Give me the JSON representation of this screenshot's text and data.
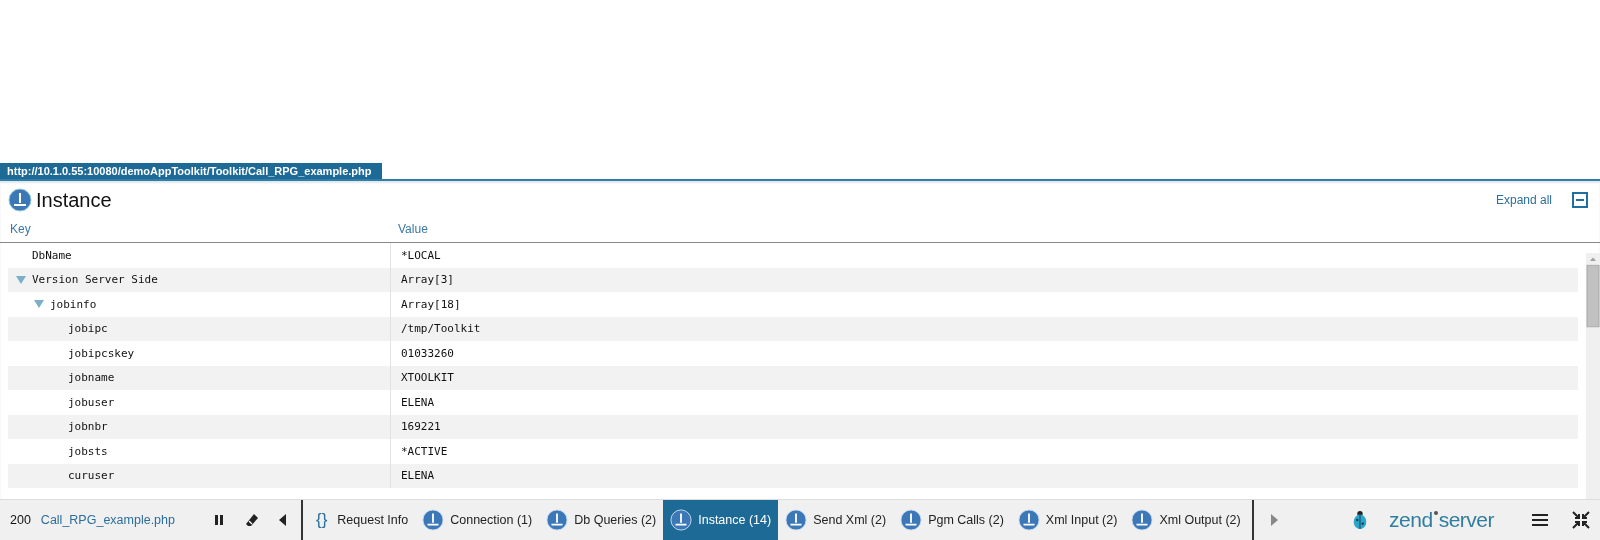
{
  "url_tab": "http://10.1.0.55:10080/demoAppToolkit/Toolkit/Call_RPG_example.php",
  "panel": {
    "title": "Instance",
    "expand_all": "Expand all"
  },
  "table": {
    "columns": [
      "Key",
      "Value"
    ],
    "rows": [
      {
        "key": "DbName",
        "value": "*LOCAL"
      },
      {
        "key": "Version Server Side",
        "value": "Array[3]",
        "expanded": true,
        "children": [
          {
            "key": "jobinfo",
            "value": "Array[18]",
            "expanded": true,
            "children": [
              {
                "key": "jobipc",
                "value": "/tmp/Toolkit"
              },
              {
                "key": "jobipcskey",
                "value": "01033260"
              },
              {
                "key": "jobname",
                "value": "XTOOLKIT"
              },
              {
                "key": "jobuser",
                "value": "ELENA"
              },
              {
                "key": "jobnbr",
                "value": "169221"
              },
              {
                "key": "jobsts",
                "value": "*ACTIVE"
              },
              {
                "key": "curuser",
                "value": "ELENA"
              }
            ]
          }
        ]
      }
    ]
  },
  "toolbar": {
    "status": "200",
    "script": "Call_RPG_example.php",
    "tabs": [
      {
        "kind": "braces",
        "icon": "{}",
        "label": "Request Info",
        "selected": false
      },
      {
        "kind": "instance",
        "label": "Connection (1)",
        "selected": false
      },
      {
        "kind": "instance",
        "label": "Db Queries (2)",
        "selected": false
      },
      {
        "kind": "instance",
        "label": "Instance (14)",
        "selected": true
      },
      {
        "kind": "instance",
        "label": "Send Xml (2)",
        "selected": false
      },
      {
        "kind": "instance",
        "label": "Pgm Calls (2)",
        "selected": false
      },
      {
        "kind": "instance",
        "label": "Xml Input (2)",
        "selected": false
      },
      {
        "kind": "instance",
        "label": "Xml Output (2)",
        "selected": false
      }
    ],
    "logo": {
      "left": "zend",
      "right": "server"
    }
  }
}
